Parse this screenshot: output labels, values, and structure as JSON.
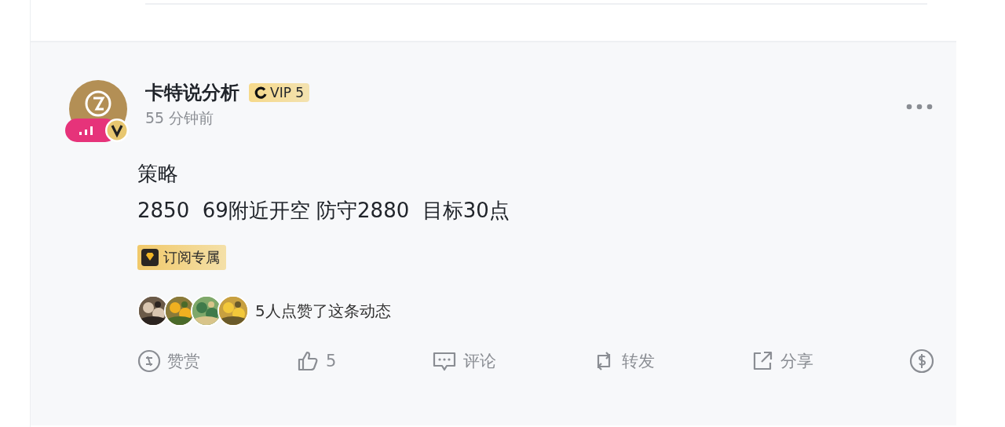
{
  "post": {
    "author": "卡特说分析",
    "vip_badge": "VIP 5",
    "time": "55 分钟前",
    "content": [
      "策略",
      "2850  69附近开空 防守2880  目标30点"
    ],
    "exclusive_tag": "订阅专属",
    "likes_text": "5人点赞了这条动态",
    "actions": [
      {
        "kind": "reward",
        "label": "赞赏"
      },
      {
        "kind": "like",
        "label": "5"
      },
      {
        "kind": "comment",
        "label": "评论"
      },
      {
        "kind": "repost",
        "label": "转发"
      },
      {
        "kind": "share",
        "label": "分享"
      },
      {
        "kind": "tip"
      }
    ]
  }
}
